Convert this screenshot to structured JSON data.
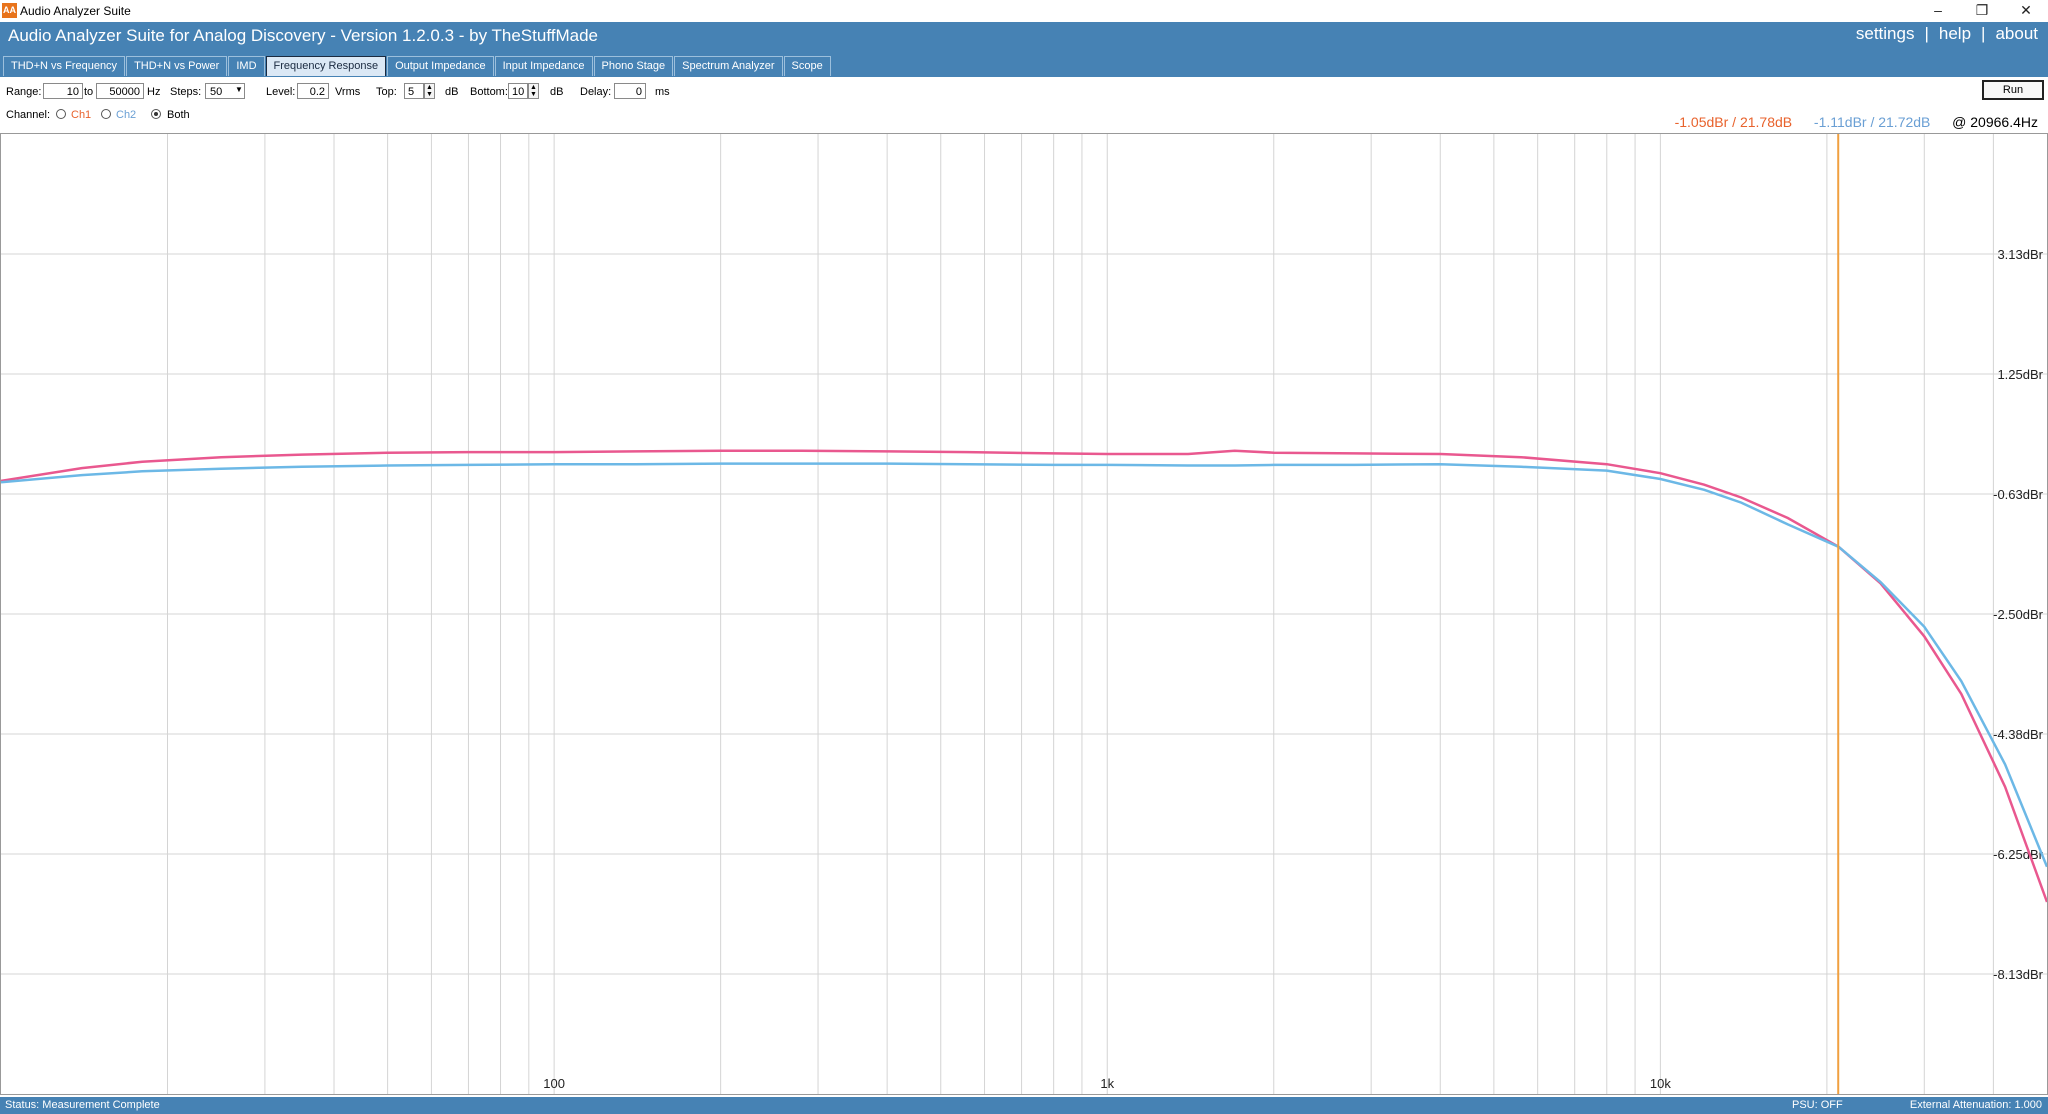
{
  "window": {
    "title": "Audio Analyzer Suite",
    "icon_label": "AA",
    "minimize": "–",
    "restore": "❐",
    "close": "✕"
  },
  "banner": {
    "title": "Audio Analyzer Suite for Analog Discovery - Version   1.2.0.3   - by TheStuffMade",
    "links": [
      "settings",
      "help",
      "about"
    ],
    "link_sep": "|"
  },
  "tabs": [
    {
      "label": "THD+N vs Frequency"
    },
    {
      "label": "THD+N vs Power"
    },
    {
      "label": "IMD"
    },
    {
      "label": "Frequency Response",
      "active": true
    },
    {
      "label": "Output Impedance"
    },
    {
      "label": "Input Impedance"
    },
    {
      "label": "Phono Stage"
    },
    {
      "label": "Spectrum Analyzer"
    },
    {
      "label": "Scope"
    }
  ],
  "controls": {
    "range_label": "Range:",
    "range_from": "10",
    "to_label": "to",
    "range_to": "50000",
    "hz_label": "Hz",
    "steps_label": "Steps:",
    "steps_value": "50",
    "level_label": "Level:",
    "level_value": "0.2",
    "vrms_label": "Vrms",
    "top_label": "Top:",
    "top_value": "5",
    "db_label": "dB",
    "bottom_label": "Bottom:",
    "bottom_value": "10",
    "db_label2": "dB",
    "delay_label": "Delay:",
    "delay_value": "0",
    "ms_label": "ms",
    "run_label": "Run"
  },
  "channel": {
    "label": "Channel:",
    "ch1": "Ch1",
    "ch2": "Ch2",
    "both": "Both",
    "selected": "Both"
  },
  "readout": {
    "ch1": "-1.05dBr / 21.78dB",
    "ch2": "-1.11dBr / 21.72dB",
    "freq": "@ 20966.4Hz"
  },
  "colors": {
    "ch1": "#e9588f",
    "ch2": "#6cb8e6",
    "ch1_readout": "#e8622c",
    "ch2_readout": "#6a9fd4",
    "cursor": "#f0a040",
    "banner": "#4682b4"
  },
  "status": {
    "text": "Status: Measurement Complete",
    "psu": "PSU: OFF",
    "attenuation": "External Attenuation: 1.000"
  },
  "chart_data": {
    "type": "line",
    "x_scale": "log",
    "xlim": [
      10,
      50000
    ],
    "ylim": [
      -10,
      5
    ],
    "x_ticks": [
      {
        "value": 100,
        "label": "100"
      },
      {
        "value": 1000,
        "label": "1k"
      },
      {
        "value": 10000,
        "label": "10k"
      }
    ],
    "y_ticks": [
      {
        "value": 3.125,
        "label": "3.13dBr"
      },
      {
        "value": 1.25,
        "label": "1.25dBr"
      },
      {
        "value": -0.625,
        "label": "-0.63dBr"
      },
      {
        "value": -2.5,
        "label": "-2.50dBr"
      },
      {
        "value": -4.375,
        "label": "-4.38dBr"
      },
      {
        "value": -6.25,
        "label": "-6.25dBr"
      },
      {
        "value": -8.125,
        "label": "-8.13dBr"
      }
    ],
    "grid": true,
    "cursor_x": 20966.4,
    "series": [
      {
        "name": "Ch1",
        "x": [
          10,
          14,
          18,
          25,
          35,
          50,
          70,
          100,
          140,
          200,
          280,
          400,
          560,
          800,
          1000,
          1400,
          1700,
          2000,
          2800,
          4000,
          5600,
          8000,
          10000,
          12000,
          14000,
          17000,
          21000,
          25000,
          30000,
          35000,
          42000,
          50000
        ],
        "values": [
          -0.42,
          -0.22,
          -0.12,
          -0.05,
          -0.01,
          0.02,
          0.03,
          0.03,
          0.04,
          0.05,
          0.05,
          0.04,
          0.03,
          0.01,
          0.0,
          0.0,
          0.05,
          0.02,
          0.01,
          0.0,
          -0.05,
          -0.16,
          -0.3,
          -0.48,
          -0.68,
          -1.0,
          -1.45,
          -2.02,
          -2.85,
          -3.75,
          -5.2,
          -7.0
        ]
      },
      {
        "name": "Ch2",
        "x": [
          10,
          14,
          18,
          25,
          35,
          50,
          70,
          100,
          140,
          200,
          280,
          400,
          560,
          800,
          1000,
          1400,
          1700,
          2000,
          2800,
          4000,
          5600,
          8000,
          10000,
          12000,
          14000,
          17000,
          21000,
          25000,
          30000,
          35000,
          42000,
          50000
        ],
        "values": [
          -0.44,
          -0.33,
          -0.27,
          -0.23,
          -0.2,
          -0.18,
          -0.17,
          -0.16,
          -0.16,
          -0.15,
          -0.15,
          -0.15,
          -0.16,
          -0.17,
          -0.17,
          -0.18,
          -0.18,
          -0.17,
          -0.17,
          -0.16,
          -0.2,
          -0.26,
          -0.39,
          -0.56,
          -0.76,
          -1.1,
          -1.45,
          -2.0,
          -2.7,
          -3.55,
          -4.85,
          -6.45
        ]
      }
    ]
  }
}
